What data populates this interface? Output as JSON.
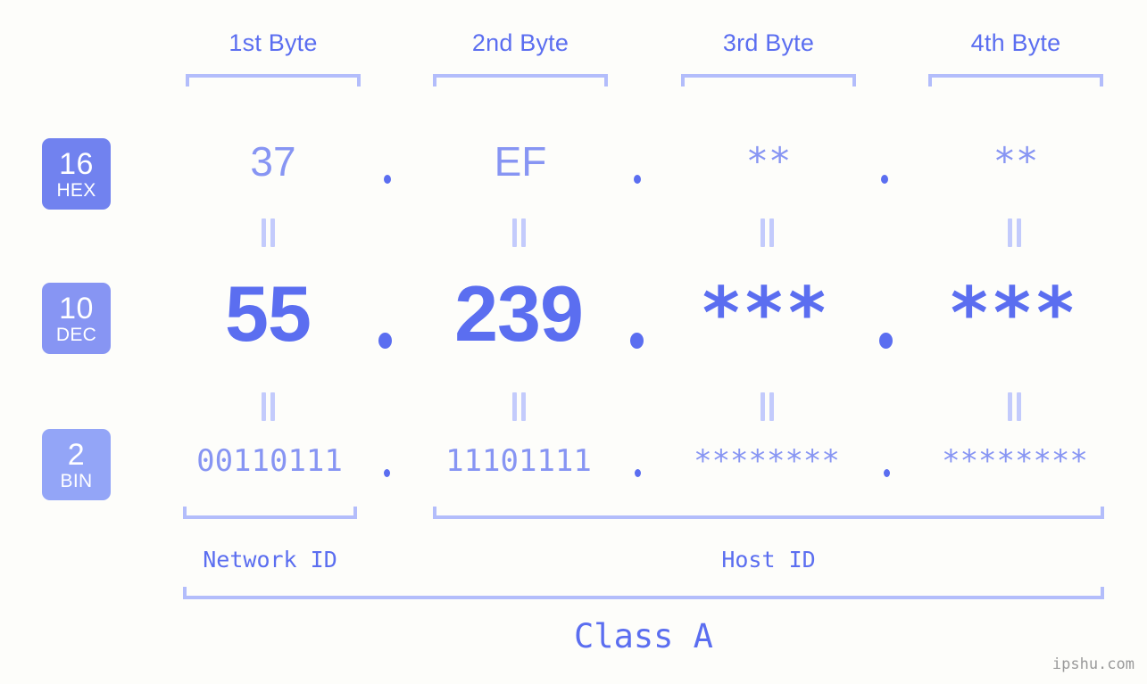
{
  "meta": {
    "background_color": "#fdfdfa",
    "accent_color": "#5b6ef0",
    "accent_light": "#8795f3",
    "accent_lighter": "#b3bdfb",
    "watermark": "ipshu.com"
  },
  "columns": [
    {
      "header": "1st Byte"
    },
    {
      "header": "2nd Byte"
    },
    {
      "header": "3rd Byte"
    },
    {
      "header": "4th Byte"
    }
  ],
  "rows": [
    {
      "badge_number": "16",
      "badge_abbr": "HEX",
      "badge_color": "#7182ef",
      "values": [
        "37",
        "EF",
        "**",
        "**"
      ]
    },
    {
      "badge_number": "10",
      "badge_abbr": "DEC",
      "badge_color": "#8795f3",
      "values": [
        "55",
        "239",
        "***",
        "***"
      ]
    },
    {
      "badge_number": "2",
      "badge_abbr": "BIN",
      "badge_color": "#93a5f7",
      "values": [
        "00110111",
        "11101111",
        "********",
        "********"
      ]
    }
  ],
  "separators": {
    "dot": ".",
    "equals": "="
  },
  "footer": {
    "network_id_label": "Network ID",
    "host_id_label": "Host ID",
    "class_label": "Class A"
  }
}
